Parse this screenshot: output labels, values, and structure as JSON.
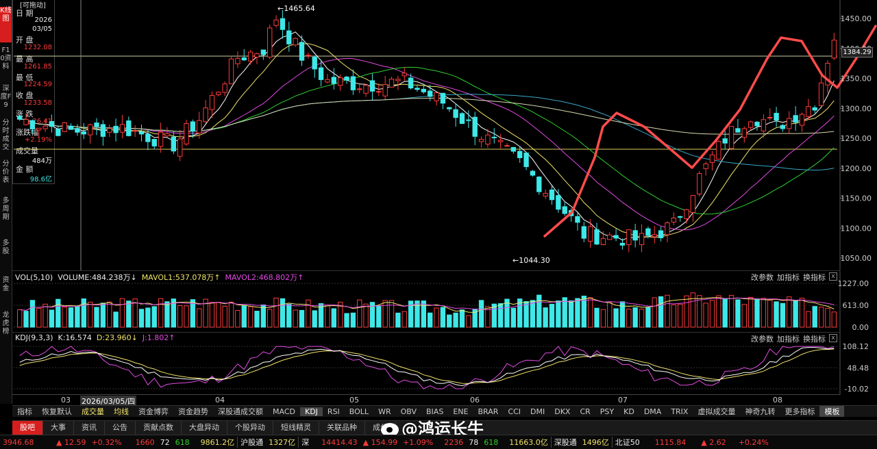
{
  "left_tabs": [
    {
      "label": "K线图",
      "active": true
    },
    {
      "label": "F10资料",
      "active": false
    },
    {
      "label": "深度F9",
      "active": false
    },
    {
      "label": "分时成交",
      "active": false
    },
    {
      "label": "分价表",
      "active": false
    },
    {
      "label": "多周期",
      "active": false
    },
    {
      "label": "多股",
      "active": false
    },
    {
      "label": "资金",
      "active": false
    },
    {
      "label": "龙虎榜",
      "active": false
    }
  ],
  "info_panel": {
    "badge": "[可拖动]",
    "date_label": "日 期",
    "year": "2026",
    "monthday": "03/05",
    "open_label": "开 盘",
    "open": "1232.08",
    "high_label": "最 高",
    "high": "1261.85",
    "low_label": "最 低",
    "low": "1224.59",
    "close_label": "收 盘",
    "close": "1233.58",
    "change_label": "涨 跌",
    "change": "▲ 26.41",
    "pct_label": "涨跌幅",
    "pct": "+2.19%",
    "vol_label": "成交量",
    "vol": "484万",
    "amt_label": "金 额",
    "amt": "98.6亿"
  },
  "main_chart": {
    "price_axis": [
      "1450.00",
      "1400.00",
      "1350.00",
      "1300.00",
      "1250.00",
      "1200.00",
      "1150.00",
      "1100.00",
      "1050.00"
    ],
    "current_price": "1384.29",
    "high_marker": "1465.64",
    "low_marker": "1044.30"
  },
  "vol_panel": {
    "title": "VOL(5,10)",
    "volume": "VOLUME:484.238万",
    "mavol1": "MAVOL1:537.078万",
    "mavol2": "MAVOL2:468.802万",
    "axis": [
      "1227.00",
      "613.00",
      "0.00"
    ],
    "btn_params": "改参数",
    "btn_add": "加指标",
    "btn_switch": "换指标",
    "close": "x"
  },
  "kdj_panel": {
    "title": "KDJ(9,3,3)",
    "k": "K:16.574",
    "d": "D:23.960",
    "j": "J:1.802",
    "axis": [
      "108.12",
      "48.48",
      "-10.02"
    ],
    "btn_params": "改参数",
    "btn_add": "加指标",
    "btn_switch": "换指标",
    "close": "x"
  },
  "date_axis": {
    "labels": [
      "03",
      "2026/03/05/四",
      "04",
      "05",
      "06",
      "07",
      "08"
    ]
  },
  "indicator_bar": [
    "指标",
    "恢复默认",
    "成交量",
    "均线",
    "资金博弈",
    "资金趋势",
    "深股通成交额",
    "MACD",
    "KDJ",
    "RSI",
    "BOLL",
    "WR",
    "OBV",
    "BIAS",
    "ENE",
    "BRAR",
    "CCI",
    "DMI",
    "DKX",
    "CR",
    "PSY",
    "KD",
    "DMA",
    "TRIX",
    "虚拟成交量",
    "神奇九转",
    "更多指标",
    "模板"
  ],
  "tab_bar": [
    "股吧",
    "大事",
    "资讯",
    "公告",
    "贡献点数",
    "大盘异动",
    "个股异动",
    "短线精灵",
    "关联品种",
    "成分"
  ],
  "watermark": "@鸿运长牛",
  "ticker": {
    "idx1_value": "3946.68",
    "idx1_change": "▲ 12.59",
    "idx1_pct": "+0.32%",
    "idx1_up": "1660",
    "idx1_flat": "72",
    "idx1_down": "618",
    "idx1_amt": "9861.2亿",
    "hgt_label": "沪股通",
    "hgt_value": "1327亿",
    "sz_label": "深",
    "sz_value": "14414.43",
    "sz_change": "▲ 154.99",
    "sz_pct": "+1.09%",
    "sz_up": "2236",
    "sz_flat": "78",
    "sz_down": "618",
    "sz_amt": "11663.0亿",
    "sgt_label": "深股通",
    "sgt_value": "1496亿",
    "bz_label": "北证50",
    "bz_value": "1115.84",
    "bz_change": "▲ 2.62",
    "bz_pct": "+0.24%"
  },
  "colors": {
    "up": "#ff3b3b",
    "down": "#3ee8e8",
    "ma1": "#ffffff",
    "ma2": "#f1e36a",
    "ma3": "#e34be3",
    "ma4": "#2fd02f",
    "ma5": "#3aa7c9",
    "trend": "#ff4c4c"
  }
}
